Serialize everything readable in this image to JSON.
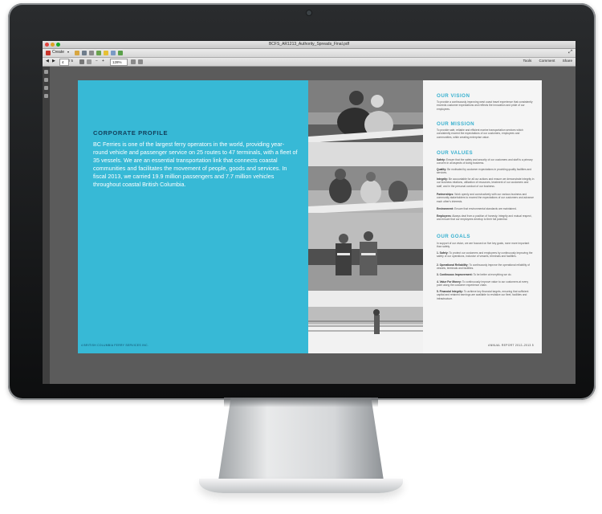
{
  "viewer": {
    "file_name": "BCFS_AR1213_Authority_Spreads_Final.pdf",
    "create_label": "Create",
    "page_current": "4",
    "page_total": "/ 5",
    "zoom": "128%",
    "tabs": [
      "Tools",
      "Comment",
      "Share"
    ]
  },
  "left_page": {
    "heading": "CORPORATE PROFILE",
    "body": "BC Ferries is one of the largest ferry operators in the world, providing year-round vehicle and passenger service on 25 routes to 47 terminals, with a fleet of 35 vessels. We are an essential transportation link that connects coastal communities and facilitates the movement of people, goods and services. In fiscal 2013, we carried 19.9 million passengers and 7.7 million vehicles throughout coastal British Columbia.",
    "footer": "4    BRITISH COLUMBIA FERRY SERVICES INC."
  },
  "right_page": {
    "vision_heading": "OUR VISION",
    "vision_text": "To provide a continuously improving west coast travel experience that consistently exceeds customer expectations and reflects the innovation and pride of our employees.",
    "mission_heading": "OUR MISSION",
    "mission_text": "To provide safe, reliable and efficient marine transportation services which consistently exceed the expectations of our customers, employees and communities, while creating enterprise value.",
    "values_heading": "OUR VALUES",
    "values": [
      {
        "term": "Safety:",
        "text": "Ensure that the safety and security of our customers and staff is a primary concern in all aspects of doing business."
      },
      {
        "term": "Quality:",
        "text": "Be motivated by customer expectations in providing quality facilities and services."
      },
      {
        "term": "Integrity:",
        "text": "Be accountable for all our actions and ensure we demonstrate integrity in our business relations, utilization of resources, treatment of our customers and staff, and in the personal conduct of our business."
      },
      {
        "term": "Partnerships:",
        "text": "Work openly and constructively with our various business and community stakeholders to exceed the expectations of our customers and advance each other's interests."
      },
      {
        "term": "Environment:",
        "text": "Ensure that environmental standards are maintained."
      },
      {
        "term": "Employees:",
        "text": "Always deal from a position of honesty, integrity and mutual respect, and ensure that our employees develop to their full potential."
      }
    ],
    "goals_heading": "OUR GOALS",
    "goals_intro": "In support of our vision, we are focused on five key goals, none more important than safety.",
    "goals": [
      {
        "term": "1. Safety:",
        "text": "To protect our customers and employees by continuously improving the safety of our operations, inclusive of vessels, terminals and facilities."
      },
      {
        "term": "2. Operational Reliability:",
        "text": "To continuously improve the operational reliability of vessels, terminals and facilities."
      },
      {
        "term": "3. Continuous Improvement:",
        "text": "To be better at everything we do."
      },
      {
        "term": "4. Value For Money:",
        "text": "To continuously improve value to our customers at every point along the customer experience chain."
      },
      {
        "term": "5. Financial Integrity:",
        "text": "To achieve key financial targets, ensuring that sufficient capital and retained earnings are available to revitalize our fleet, facilities and infrastructure."
      }
    ],
    "footer": "ANNUAL REPORT 2012–2013    5"
  }
}
